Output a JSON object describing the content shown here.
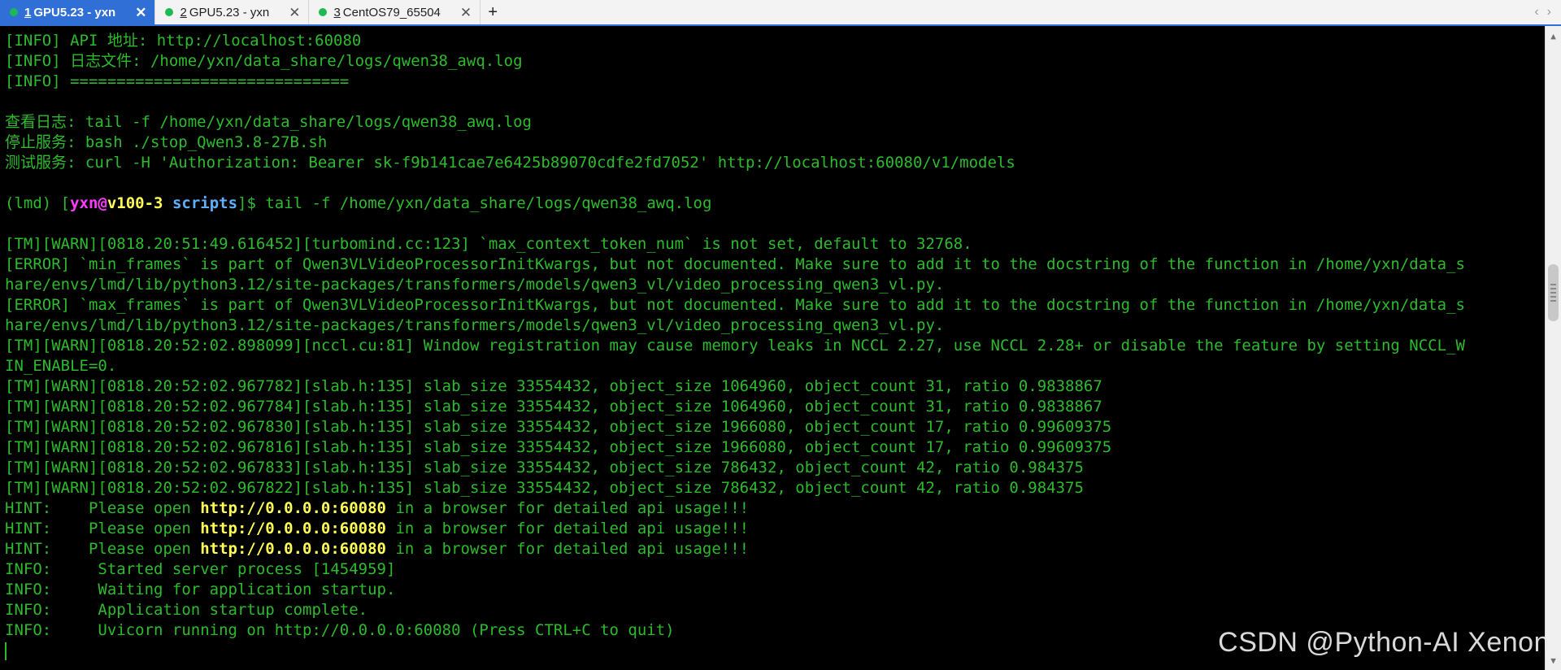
{
  "tabs": [
    {
      "number": "1",
      "label": "GPU5.23 - yxn",
      "active": true,
      "status_color": "#1db954"
    },
    {
      "number": "2",
      "label": "GPU5.23 - yxn",
      "active": false,
      "status_color": "#1db954"
    },
    {
      "number": "3",
      "label": "CentOS79_65504",
      "active": false,
      "status_color": "#1db954"
    }
  ],
  "tab_controls": {
    "add": "+",
    "close": "✕",
    "prev": "‹",
    "next": "›"
  },
  "terminal": {
    "lines": [
      "[INFO] API 地址: http://localhost:60080",
      "[INFO] 日志文件: /home/yxn/data_share/logs/qwen38_awq.log",
      "[INFO] ==============================",
      "",
      "查看日志: tail -f /home/yxn/data_share/logs/qwen38_awq.log",
      "停止服务: bash ./stop_Qwen3.8-27B.sh",
      "测试服务: curl -H 'Authorization: Bearer sk-f9b141cae7e6425b89070cdfe2fd7052' http://localhost:60080/v1/models",
      "",
      "",
      "",
      "[TM][WARN][0818.20:51:49.616452][turbomind.cc:123] `max_context_token_num` is not set, default to 32768.",
      "[ERROR] `min_frames` is part of Qwen3VLVideoProcessorInitKwargs, but not documented. Make sure to add it to the docstring of the function in /home/yxn/data_s",
      "hare/envs/lmd/lib/python3.12/site-packages/transformers/models/qwen3_vl/video_processing_qwen3_vl.py.",
      "[ERROR] `max_frames` is part of Qwen3VLVideoProcessorInitKwargs, but not documented. Make sure to add it to the docstring of the function in /home/yxn/data_s",
      "hare/envs/lmd/lib/python3.12/site-packages/transformers/models/qwen3_vl/video_processing_qwen3_vl.py.",
      "[TM][WARN][0818.20:52:02.898099][nccl.cu:81] Window registration may cause memory leaks in NCCL 2.27, use NCCL 2.28+ or disable the feature by setting NCCL_W",
      "IN_ENABLE=0.",
      "[TM][WARN][0818.20:52:02.967782][slab.h:135] slab_size 33554432, object_size 1064960, object_count 31, ratio 0.9838867",
      "[TM][WARN][0818.20:52:02.967784][slab.h:135] slab_size 33554432, object_size 1064960, object_count 31, ratio 0.9838867",
      "[TM][WARN][0818.20:52:02.967830][slab.h:135] slab_size 33554432, object_size 1966080, object_count 17, ratio 0.99609375",
      "[TM][WARN][0818.20:52:02.967816][slab.h:135] slab_size 33554432, object_size 1966080, object_count 17, ratio 0.99609375",
      "[TM][WARN][0818.20:52:02.967833][slab.h:135] slab_size 33554432, object_size 786432, object_count 42, ratio 0.984375",
      "[TM][WARN][0818.20:52:02.967822][slab.h:135] slab_size 33554432, object_size 786432, object_count 42, ratio 0.984375",
      "",
      "",
      "",
      "INFO:     Started server process [1454959]",
      "INFO:     Waiting for application startup.",
      "INFO:     Application startup complete.",
      "INFO:     Uvicorn running on http://0.0.0.0:60080 (Press CTRL+C to quit)"
    ],
    "prompt": {
      "env": "(lmd) [",
      "user": "yxn",
      "at": "@",
      "host": "v100-3",
      "space": " ",
      "dir": "scripts",
      "suffix": "]$ ",
      "command": "tail -f /home/yxn/data_share/logs/qwen38_awq.log"
    },
    "hint": {
      "prefix": "HINT:    Please open ",
      "url": "http://0.0.0.0:60080",
      "suffix": " in a browser for detailed api usage!!!"
    }
  },
  "watermark": "CSDN @Python-AI Xenon",
  "colors": {
    "terminal_text": "#2dbb2d",
    "terminal_bg": "#000000",
    "tab_active_bg": "#2f6fd6",
    "highlight_yellow": "#ffff55",
    "prompt_user": "#ff3cff",
    "prompt_dir": "#5fafff"
  }
}
